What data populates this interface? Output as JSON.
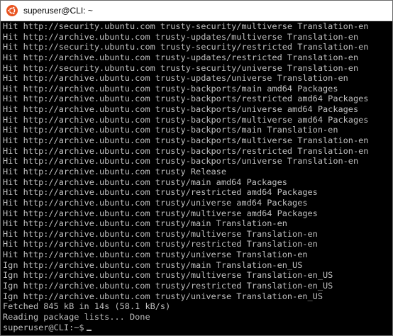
{
  "window": {
    "title": "superuser@CLI: ~",
    "icon": "ubuntu-logo-icon",
    "accent_color": "#e95420"
  },
  "terminal": {
    "background": "#000000",
    "foreground": "#c0c0c0",
    "lines": [
      "Hit http://security.ubuntu.com trusty-security/multiverse Translation-en",
      "Hit http://archive.ubuntu.com trusty-updates/multiverse Translation-en",
      "Hit http://security.ubuntu.com trusty-security/restricted Translation-en",
      "Hit http://archive.ubuntu.com trusty-updates/restricted Translation-en",
      "Hit http://security.ubuntu.com trusty-security/universe Translation-en",
      "Hit http://archive.ubuntu.com trusty-updates/universe Translation-en",
      "Hit http://archive.ubuntu.com trusty-backports/main amd64 Packages",
      "Hit http://archive.ubuntu.com trusty-backports/restricted amd64 Packages",
      "Hit http://archive.ubuntu.com trusty-backports/universe amd64 Packages",
      "Hit http://archive.ubuntu.com trusty-backports/multiverse amd64 Packages",
      "Hit http://archive.ubuntu.com trusty-backports/main Translation-en",
      "Hit http://archive.ubuntu.com trusty-backports/multiverse Translation-en",
      "Hit http://archive.ubuntu.com trusty-backports/restricted Translation-en",
      "Hit http://archive.ubuntu.com trusty-backports/universe Translation-en",
      "Hit http://archive.ubuntu.com trusty Release",
      "Hit http://archive.ubuntu.com trusty/main amd64 Packages",
      "Hit http://archive.ubuntu.com trusty/restricted amd64 Packages",
      "Hit http://archive.ubuntu.com trusty/universe amd64 Packages",
      "Hit http://archive.ubuntu.com trusty/multiverse amd64 Packages",
      "Hit http://archive.ubuntu.com trusty/main Translation-en",
      "Hit http://archive.ubuntu.com trusty/multiverse Translation-en",
      "Hit http://archive.ubuntu.com trusty/restricted Translation-en",
      "Hit http://archive.ubuntu.com trusty/universe Translation-en",
      "Ign http://archive.ubuntu.com trusty/main Translation-en_US",
      "Ign http://archive.ubuntu.com trusty/multiverse Translation-en_US",
      "Ign http://archive.ubuntu.com trusty/restricted Translation-en_US",
      "Ign http://archive.ubuntu.com trusty/universe Translation-en_US",
      "Fetched 845 kB in 14s (58.1 kB/s)",
      "Reading package lists... Done"
    ],
    "prompt": "superuser@CLI:~$"
  }
}
